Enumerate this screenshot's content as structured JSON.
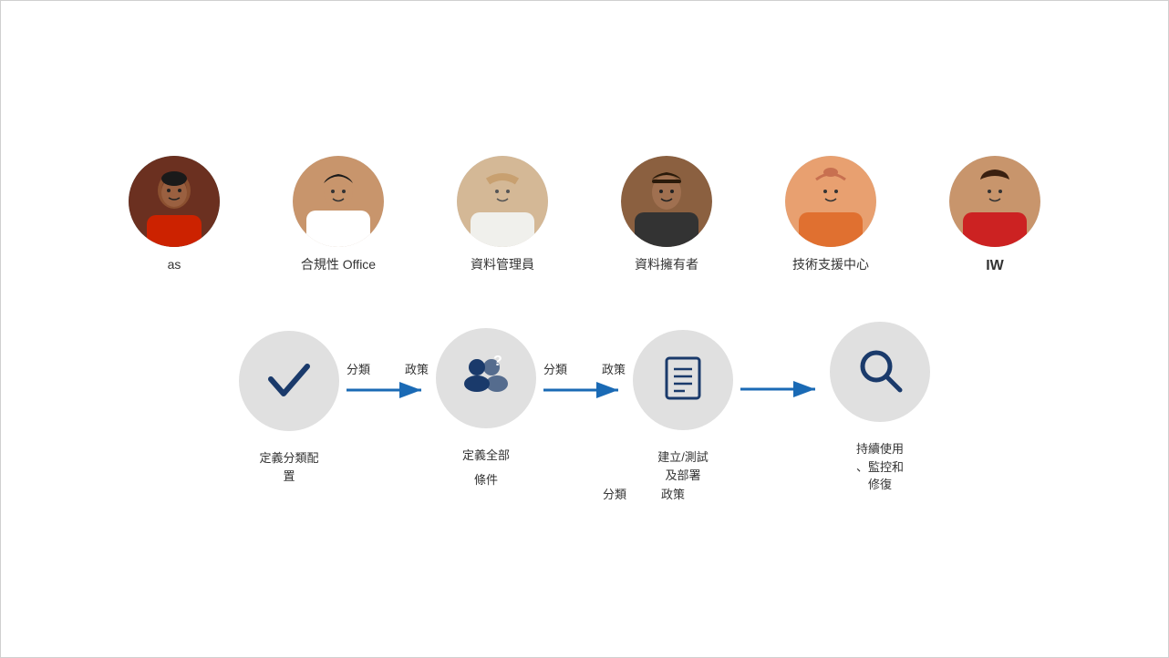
{
  "personas": [
    {
      "id": "persona-1",
      "label": "as",
      "bold": false,
      "avatarColor1": "#e8a090",
      "avatarColor2": "#c05030",
      "skinTone": "#8B4513",
      "shirtColor": "#cc2200"
    },
    {
      "id": "persona-2",
      "label": "合規性 Office",
      "bold": false,
      "avatarColor1": "#d4a57a",
      "avatarColor2": "#a07040",
      "skinTone": "#c8956c",
      "shirtColor": "#ffffff"
    },
    {
      "id": "persona-3",
      "label": "資料管理員",
      "bold": false,
      "avatarColor1": "#e0c8a8",
      "avatarColor2": "#b09070",
      "skinTone": "#e0c8a8",
      "shirtColor": "#f0f0f0"
    },
    {
      "id": "persona-4",
      "label": "資料擁有者",
      "bold": false,
      "avatarColor1": "#a08060",
      "avatarColor2": "#806040",
      "skinTone": "#a08060",
      "shirtColor": "#444444"
    },
    {
      "id": "persona-5",
      "label": "技術支援中心",
      "bold": false,
      "avatarColor1": "#e87040",
      "avatarColor2": "#c05020",
      "skinTone": "#e8a070",
      "shirtColor": "#e87040"
    },
    {
      "id": "persona-6",
      "label": "IW",
      "bold": true,
      "avatarColor1": "#c8956c",
      "avatarColor2": "#a07040",
      "skinTone": "#c8956c",
      "shirtColor": "#cc2222"
    }
  ],
  "process": {
    "steps": [
      {
        "id": "step-1",
        "icon": "checkmark",
        "mainLabel": "定義分類配\n置",
        "subLabel": ""
      },
      {
        "id": "step-2",
        "icon": "people-question",
        "mainLabel": "定義全部",
        "subLabel": "條件"
      },
      {
        "id": "step-3",
        "icon": "checklist",
        "mainLabel": "建立/測試\n及部署",
        "subLabel": ""
      },
      {
        "id": "step-4",
        "icon": "search",
        "mainLabel": "持續使用\n、監控和\n修復",
        "subLabel": ""
      }
    ],
    "arrows": [
      {
        "topLabel": "分類",
        "bottomLabel": "政策"
      },
      {
        "topLabel": "分類",
        "bottomLabel": "政策"
      },
      {
        "topLabel": "",
        "bottomLabel": ""
      }
    ],
    "arrowBetween1_2": {
      "above": "分類",
      "below": "政策"
    },
    "arrowBetween2_3": {
      "above": "分類",
      "below": "政策"
    },
    "arrowBetween3_4": {
      "above": "",
      "below": ""
    }
  },
  "arrowColor": "#1a6ab5",
  "circleColor": "#e0e0e0",
  "iconColor": "#1a3a6b"
}
